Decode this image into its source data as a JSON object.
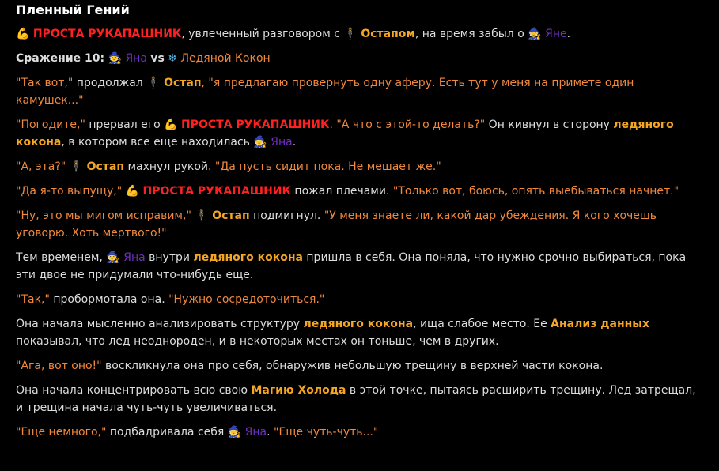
{
  "title": "Пленный Гений",
  "emojis": {
    "muscle": "💪",
    "ostap": "🕴",
    "yana": "🧙",
    "snow": "❄"
  },
  "p1": {
    "warrior": "ПРОСТА РУКАПАШНИК",
    "t1": ", увлеченный разговором с ",
    "ostap": "Остапом",
    "t2": ", на время забыл о ",
    "yana": "Яне",
    "t3": "."
  },
  "battle": {
    "label": "Сражение 10:",
    "yana": "Яна",
    "vs": "vs",
    "cocoon": "Ледяной Кокон"
  },
  "p2": {
    "q1": "\"Так вот,\"",
    "t1": " продолжал ",
    "ostap": "Остап",
    "q2": ", \"я предлагаю провернуть одну аферу. Есть тут у меня на примете один камушек...\""
  },
  "p3": {
    "q1": "\"Погодите,\"",
    "t1": " прервал его ",
    "warrior": "ПРОСТА РУКАПАШНИК",
    "q2": ". \"А что с этой-то делать?\"",
    "t2": " Он кивнул в сторону ",
    "hl": "ледяного кокона",
    "t3": ", в котором все еще находилась ",
    "yana": "Яна",
    "t4": "."
  },
  "p4": {
    "q1": "\"А, эта?\"",
    "ostap": "Остап",
    "t1": " махнул рукой. ",
    "q2": "\"Да пусть сидит пока. Не мешает же.\""
  },
  "p5": {
    "q1": "\"Да я-то выпущу,\"",
    "warrior": "ПРОСТА РУКАПАШНИК",
    "t1": " пожал плечами. ",
    "q2": "\"Только вот, боюсь, опять выебываться начнет.\""
  },
  "p6": {
    "q1": "\"Ну, это мы мигом исправим,\"",
    "ostap": "Остап",
    "t1": " подмигнул. ",
    "q2": "\"У меня знаете ли, какой дар убеждения. Я кого хочешь уговорю. Хоть мертвого!\""
  },
  "p7": {
    "t1": "Тем временем, ",
    "yana": "Яна",
    "t2": " внутри ",
    "hl": "ледяного кокона",
    "t3": " пришла в себя. Она поняла, что нужно срочно выбираться, пока эти двое не придумали что-нибудь еще."
  },
  "p8": {
    "q1": "\"Так,\"",
    "t1": " пробормотала она. ",
    "q2": "\"Нужно сосредоточиться.\""
  },
  "p9": {
    "t1": "Она начала мысленно анализировать структуру ",
    "hl1": "ледяного кокона",
    "t2": ", ища слабое место. Ее ",
    "hl2": "Анализ данных",
    "t3": " показывал, что лед неоднороден, и в некоторых местах он тоньше, чем в других."
  },
  "p10": {
    "q1": "\"Ага, вот оно!\"",
    "t1": " воскликнула она про себя, обнаружив небольшую трещину в верхней части кокона."
  },
  "p11": {
    "t1": "Она начала концентрировать всю свою ",
    "hl": "Магию Холода",
    "t2": " в этой точке, пытаясь расширить трещину. Лед затрещал, и трещина начала чуть-чуть увеличиваться."
  },
  "p12": {
    "q1": "\"Еще немного,\"",
    "t1": " подбадривала себя ",
    "yana": "Яна",
    "t2": ". ",
    "q2": "\"Еще чуть-чуть...\""
  }
}
